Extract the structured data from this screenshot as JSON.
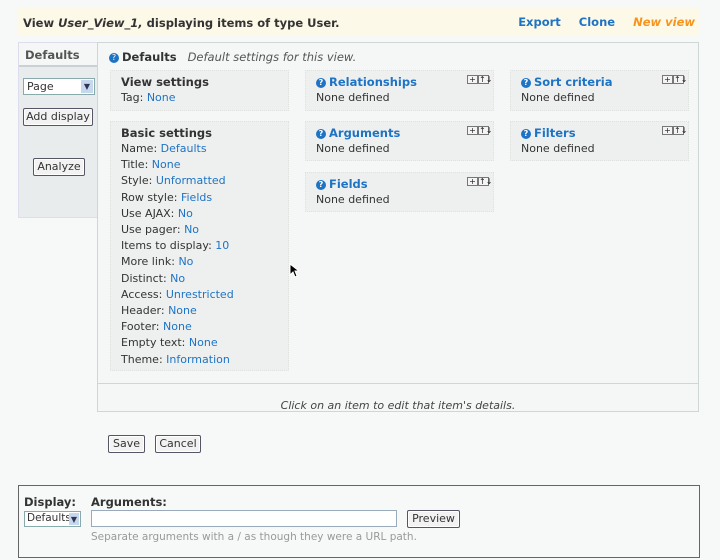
{
  "header": {
    "title_prefix": "View ",
    "view_name": "User_View_1,",
    "title_suffix": " displaying items of type User.",
    "links": [
      "Export",
      "Clone",
      "New view"
    ]
  },
  "sidebar": {
    "tab": "Defaults",
    "display_select": "Page",
    "add_display": "Add display",
    "analyze": "Analyze"
  },
  "main": {
    "title": "Defaults",
    "subtitle": "Default settings for this view.",
    "view_settings": {
      "title": "View settings",
      "items": [
        {
          "label": "Tag:",
          "value": "None"
        }
      ]
    },
    "basic_settings": {
      "title": "Basic settings",
      "items": [
        {
          "label": "Name:",
          "value": "Defaults"
        },
        {
          "label": "Title:",
          "value": "None"
        },
        {
          "label": "Style:",
          "value": "Unformatted"
        },
        {
          "label": "Row style:",
          "value": "Fields"
        },
        {
          "label": "Use AJAX:",
          "value": "No"
        },
        {
          "label": "Use pager:",
          "value": "No"
        },
        {
          "label": "Items to display:",
          "value": "10"
        },
        {
          "label": "More link:",
          "value": "No"
        },
        {
          "label": "Distinct:",
          "value": "No"
        },
        {
          "label": "Access:",
          "value": "Unrestricted"
        },
        {
          "label": "Header:",
          "value": "None"
        },
        {
          "label": "Footer:",
          "value": "None"
        },
        {
          "label": "Empty text:",
          "value": "None"
        },
        {
          "label": "Theme:",
          "value": "Information"
        }
      ]
    },
    "sections": [
      {
        "title": "Relationships",
        "body": "None defined"
      },
      {
        "title": "Arguments",
        "body": "None defined"
      },
      {
        "title": "Fields",
        "body": "None defined"
      },
      {
        "title": "Sort criteria",
        "body": "None defined"
      },
      {
        "title": "Filters",
        "body": "None defined"
      }
    ],
    "add_icon": "+",
    "rearrange_icon": "↑↓",
    "footer": "Click on an item to edit that item's details."
  },
  "actions": {
    "save": "Save",
    "cancel": "Cancel"
  },
  "preview": {
    "display_label": "Display:",
    "display_value": "Defaults",
    "arguments_label": "Arguments:",
    "arguments_value": "",
    "preview_button": "Preview",
    "hint": "Separate arguments with a / as though they were a URL path."
  },
  "colors": {
    "link": "#1e73c5",
    "new_view": "#f7941d",
    "header_bg": "#fdf9e8"
  }
}
